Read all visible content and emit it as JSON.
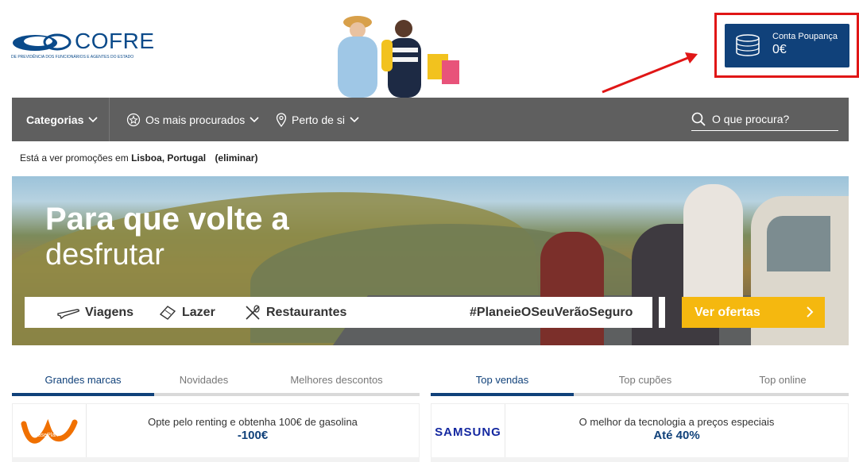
{
  "brand": {
    "name": "COFRE",
    "subtitle": "DE PREVIDÊNCIA DOS FUNCIONÁRIOS E AGENTES DO ESTADO",
    "color": "#0a4a8a"
  },
  "account": {
    "label": "Conta Poupança",
    "value": "0€",
    "bg": "#10417a",
    "highlight_color": "#e01616"
  },
  "nav": {
    "categories": "Categorias",
    "most_searched": "Os mais procurados",
    "near_you": "Perto de si",
    "search_placeholder": "O que procura?"
  },
  "location": {
    "prefix": "Está a ver promoções em",
    "place": "Lisboa, Portugal",
    "remove": "(eliminar)"
  },
  "banner": {
    "title_line1": "Para que volte a",
    "title_line2": "desfrutar",
    "categories": [
      "Viagens",
      "Lazer",
      "Restaurantes"
    ],
    "hashtag": "#PlaneieOSeuVerãoSeguro",
    "cta": "Ver ofertas",
    "cta_color": "#f5b80f"
  },
  "tabs_left": {
    "items": [
      "Grandes marcas",
      "Novidades",
      "Melhores descontos"
    ],
    "active": "Grandes marcas"
  },
  "tabs_right": {
    "items": [
      "Top vendas",
      "Top cupões",
      "Top online"
    ],
    "active": "Top vendas"
  },
  "offers_left": [
    {
      "brand": "LeasePlan",
      "text": "Opte pelo renting e obtenha 100€ de gasolina",
      "discount": "-100€"
    }
  ],
  "offers_right": [
    {
      "brand": "SAMSUNG",
      "text": "O melhor da tecnologia a preços especiais",
      "discount": "Até 40%"
    }
  ]
}
